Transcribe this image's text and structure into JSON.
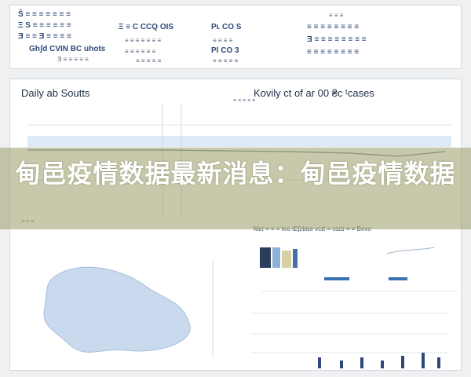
{
  "top_panel": {
    "col1": [
      "Ŝ ≡ ≡ ≡ ≡ ≡ ≡ ≡",
      "Ξ S ≡ ≡ ≡ ≡ ≡ ≡",
      "Ǝ ≡ ≡ Ǝ ≡ ≡ ≡ ≡",
      "Ghʃd CVIN BC uhots",
      "Ǝ ≡ ≡ ≡ ≡ ≡"
    ],
    "col2": [
      "Ξ ≡ C CCQ OIS",
      "≡ ≡ ≡ ≡ ≡ ≡ ≡",
      "≡ ≡ ≡ ≡ ≡ ≡",
      "≡ ≡ ≡ ≡ ≡"
    ],
    "col3": [
      "Pʟ CO S",
      "≡ ≡ ≡ ≡",
      "Pl CO 3",
      "≡ ≡ ≡ ≡ ≡"
    ],
    "col4": [
      "≡ ≡ ≡",
      "≡ ≡ ≡ ≡ ≡ ≡ ≡ ≡",
      "Ǝ ≡ ≡ ≡ ≡ ≡ ≡ ≡ ≡",
      "≡ ≡ ≡ ≡ ≡ ≡ ≡ ≡"
    ]
  },
  "main": {
    "title_left": "Daily ab Soutts",
    "title_right": "Kovily ct of ar 00 ₴c ᵗcases",
    "chart_small_labels": [
      "≡ ≡ ≡ ≡ ≡",
      "≡ ≡ ≡ ≡",
      "≡ ≡ ≡",
      "≡ ≡",
      "≡ ≡ ≡"
    ],
    "right_panel_title": "Μεℓ ≡ ≡ ≡ Ieɢ tEʃzbiɪe vcɪt ≡ oɪɪtɪ ≡ ≡ Bevo"
  },
  "overlay": {
    "title": "甸邑疫情数据最新消息：甸邑疫情数据"
  },
  "colors": {
    "accent": "#3a6fb0",
    "band": "#dfeaf8",
    "overlay": "#a0a06e",
    "map_fill": "#c9d9ee"
  }
}
